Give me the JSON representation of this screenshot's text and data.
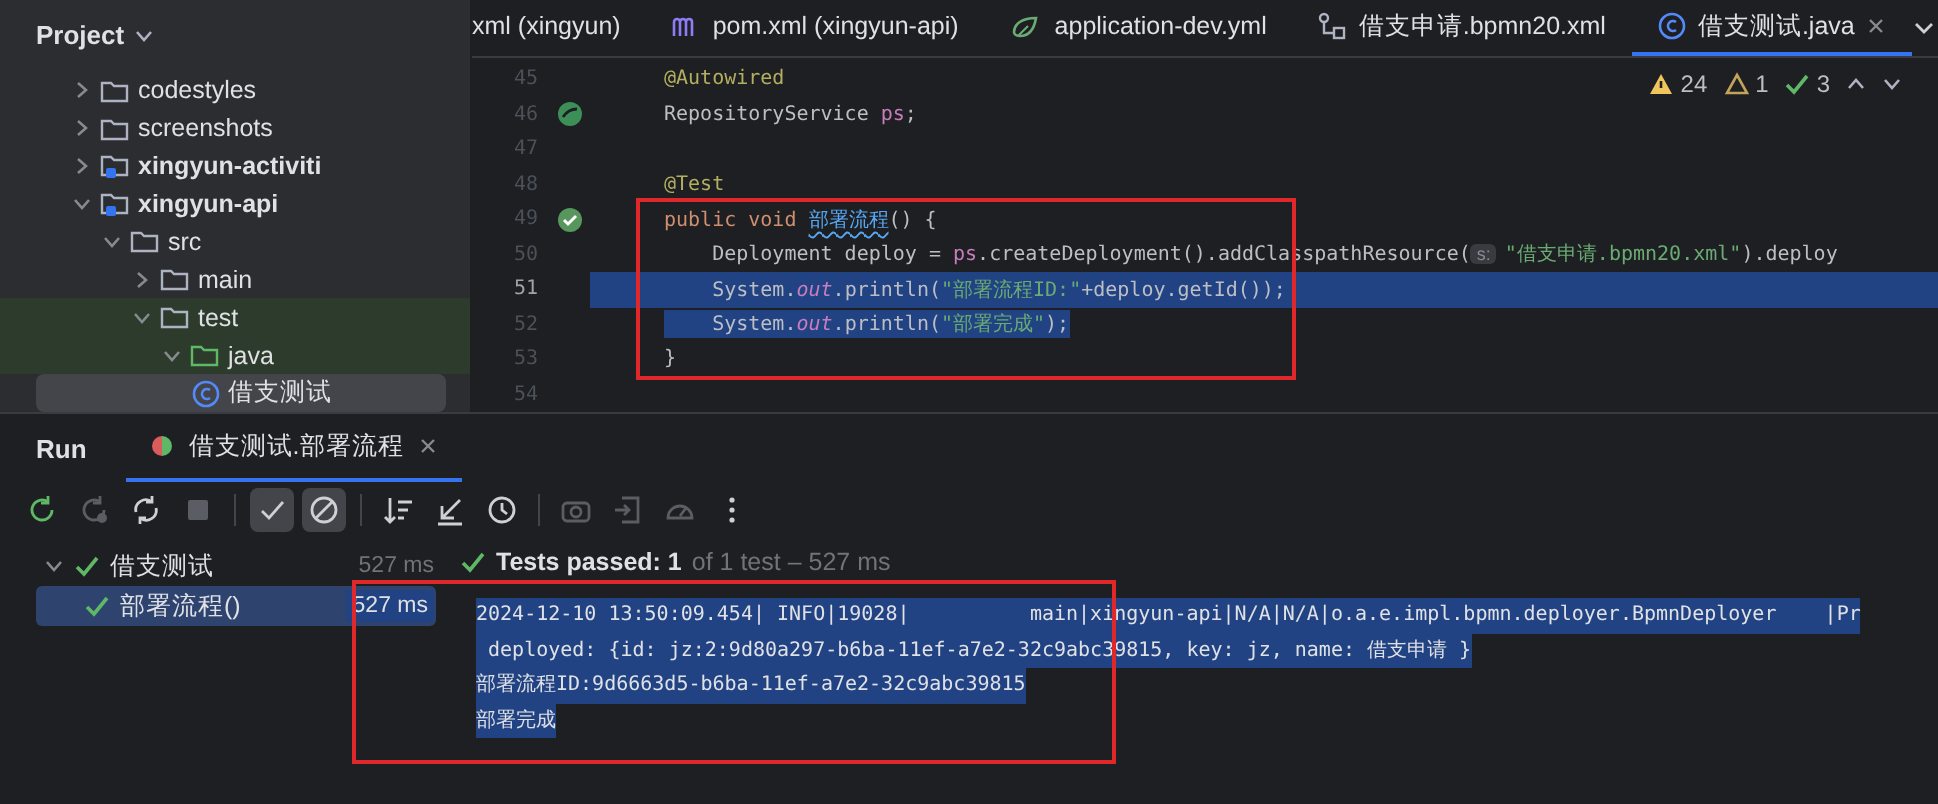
{
  "project": {
    "title": "Project",
    "tree": [
      {
        "label": "codestyles",
        "kind": "folder",
        "expanded": false,
        "selected": false
      },
      {
        "label": "screenshots",
        "kind": "folder",
        "expanded": false,
        "selected": false
      },
      {
        "label": "xingyun-activiti",
        "kind": "module",
        "expanded": false,
        "selected": false
      },
      {
        "label": "xingyun-api",
        "kind": "module",
        "expanded": true,
        "selected": false,
        "children": [
          {
            "label": "src",
            "kind": "folder",
            "expanded": true,
            "selected": false,
            "children": [
              {
                "label": "main",
                "kind": "folder",
                "expanded": false,
                "selected": false
              },
              {
                "label": "test",
                "kind": "folder",
                "expanded": true,
                "selected": false,
                "test_scope": true,
                "children": [
                  {
                    "label": "java",
                    "kind": "test-source",
                    "expanded": true,
                    "selected": false,
                    "children": [
                      {
                        "label": "借支测试",
                        "kind": "class",
                        "selected": true
                      }
                    ]
                  }
                ]
              }
            ]
          }
        ]
      }
    ]
  },
  "editor": {
    "tabs": [
      {
        "label": "xml (xingyun)",
        "kind": "plain",
        "selected": false
      },
      {
        "label": "pom.xml (xingyun-api)",
        "kind": "maven",
        "selected": false
      },
      {
        "label": "application-dev.yml",
        "kind": "yaml",
        "selected": false
      },
      {
        "label": "借支申请.bpmn20.xml",
        "kind": "bpmn",
        "selected": false
      },
      {
        "label": "借支测试.java",
        "kind": "class",
        "selected": true
      }
    ],
    "inspections": [
      {
        "kind": "warning",
        "count": "24"
      },
      {
        "kind": "weak-warning",
        "count": "1"
      },
      {
        "kind": "typo",
        "count": "3"
      }
    ],
    "lines": [
      {
        "number": "45",
        "current": false,
        "tokens": [
          {
            "kind": "annotation",
            "text": "@Autowired"
          }
        ]
      },
      {
        "number": "46",
        "gutter_icon": {
          "kind": "bean"
        },
        "current": false,
        "tokens": [
          {
            "kind": "plain",
            "text": "RepositoryService "
          },
          {
            "kind": "field",
            "text": "ps"
          },
          {
            "kind": "plain",
            "text": ";"
          }
        ]
      },
      {
        "number": "47",
        "current": false
      },
      {
        "number": "48",
        "current": false,
        "tokens": [
          {
            "kind": "annotation",
            "text": "@Test"
          }
        ]
      },
      {
        "number": "49",
        "gutter_icon": {
          "kind": "run-passed"
        },
        "current": false,
        "tokens": [
          {
            "kind": "keyword",
            "text": "public void "
          },
          {
            "kind": "method",
            "text": "部署流程"
          },
          {
            "kind": "plain",
            "text": "() {"
          }
        ]
      },
      {
        "number": "50",
        "current": false,
        "tokens": [
          {
            "kind": "plain",
            "text": "    Deployment deploy = "
          },
          {
            "kind": "field",
            "text": "ps"
          },
          {
            "kind": "plain",
            "text": ".createDeployment().addClasspathResource("
          },
          {
            "kind": "hint",
            "text": "s:"
          },
          {
            "kind": "string",
            "text": "\"借支申请.bpmn20.xml\""
          },
          {
            "kind": "plain",
            "text": ").deploy"
          }
        ]
      },
      {
        "number": "51",
        "selected": true,
        "full_line": true,
        "current": true,
        "tokens": [
          {
            "kind": "plain",
            "text": "    System."
          },
          {
            "kind": "static",
            "text": "out"
          },
          {
            "kind": "plain",
            "text": ".println("
          },
          {
            "kind": "string",
            "text": "\"部署流程ID:\""
          },
          {
            "kind": "plain",
            "text": "+deploy.getId());"
          }
        ]
      },
      {
        "number": "52",
        "selected": true,
        "full_line": false,
        "current": false,
        "tokens": [
          {
            "kind": "plain",
            "text": "    System."
          },
          {
            "kind": "static",
            "text": "out"
          },
          {
            "kind": "plain",
            "text": ".println("
          },
          {
            "kind": "string",
            "text": "\"部署完成\""
          },
          {
            "kind": "plain",
            "text": ");"
          }
        ]
      },
      {
        "number": "53",
        "current": false,
        "tokens": [
          {
            "kind": "plain",
            "text": "}"
          }
        ]
      },
      {
        "number": "54",
        "current": false
      }
    ]
  },
  "run": {
    "title": "Run",
    "tabs": [
      {
        "label": "借支测试.部署流程",
        "selected": true
      }
    ],
    "toolbar": [
      {
        "kind": "rerun",
        "on": false,
        "disabled": false
      },
      {
        "kind": "rerun-failed",
        "on": false,
        "disabled": true
      },
      {
        "kind": "toggle-auto",
        "on": false,
        "disabled": false
      },
      {
        "kind": "stop",
        "on": false,
        "disabled": true
      },
      {
        "kind": "show-passed",
        "on": true,
        "disabled": false
      },
      {
        "kind": "show-ignored",
        "on": true,
        "disabled": false
      },
      {
        "kind": "sort",
        "on": false,
        "disabled": false
      },
      {
        "kind": "import",
        "on": false,
        "disabled": false
      },
      {
        "kind": "history",
        "on": false,
        "disabled": false
      },
      {
        "kind": "screenshot",
        "on": false,
        "disabled": true
      },
      {
        "kind": "export",
        "on": false,
        "disabled": true
      },
      {
        "kind": "coverage",
        "on": false,
        "disabled": true
      },
      {
        "kind": "more",
        "on": false,
        "disabled": false
      }
    ],
    "tests": [
      {
        "label": "借支测试",
        "duration": "527 ms",
        "passed": true,
        "expanded": true,
        "selected": false,
        "children": [
          {
            "label": "部署流程()",
            "duration": "527 ms",
            "passed": true,
            "selected": true
          }
        ]
      }
    ],
    "status": {
      "headline": "Tests passed: 1",
      "detail": "of 1 test – 527 ms"
    },
    "console": [
      {
        "text": "2024-12-10 13:50:09.454| INFO|19028|          main|xingyun-api|N/A|N/A|o.a.e.impl.bpmn.deployer.BpmnDeployer    |Pr",
        "selected": true
      },
      {
        "text": " deployed: {id: jz:2:9d80a297-b6ba-11ef-a7e2-32c9abc39815, key: jz, name: 借支申请 }",
        "selected": true
      },
      {
        "text": "部署流程ID:9d6663d5-b6ba-11ef-a7e2-32c9abc39815",
        "selected": true
      },
      {
        "text": "部署完成",
        "selected": true
      }
    ]
  },
  "annotations": [
    {
      "kind": "frame"
    },
    {
      "kind": "frame"
    }
  ]
}
